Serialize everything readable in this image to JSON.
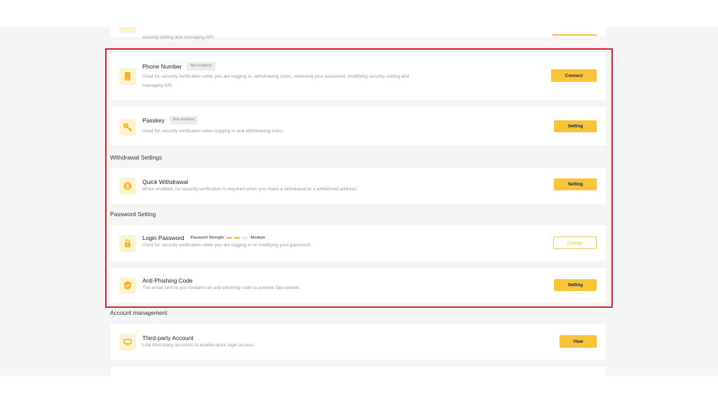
{
  "top_card": {
    "desc_tail": "security setting and managing API."
  },
  "security_items": [
    {
      "title": "Phone Number",
      "badge": "Not enabled",
      "desc": "Used for security verification while you are logging in, withdrawing coins, retrieving your password, modifying security setting and managing API.",
      "button": "Connect",
      "icon": "phone-icon"
    },
    {
      "title": "Passkey",
      "badge": "Not enabled",
      "desc": "Used for security verification when logging in and withdrawing coins.",
      "button": "Setting",
      "icon": "passkey-icon"
    }
  ],
  "withdrawal_section": {
    "title": "Withdrawal Settings",
    "items": [
      {
        "title": "Quick Withdrawal",
        "desc": "When enabled, no security verification is required when you make a withdrawal to a whitelisted address.",
        "button": "Setting",
        "icon": "quick-withdrawal-icon"
      }
    ]
  },
  "password_section": {
    "title": "Password Setting",
    "items": [
      {
        "title": "Login Password",
        "strength_label": "Password Strength:",
        "strength_value": "Medium",
        "strength_level": 2,
        "strength_max": 3,
        "desc": "Used for security verification while you are logging in or modifying your password.",
        "button": "Change",
        "icon": "lock-icon"
      },
      {
        "title": "Anti-Phishing Code",
        "desc": "The email sent to you contains an anti-phishing code to prevent fake emails.",
        "button": "Setting",
        "icon": "shield-check-icon"
      }
    ]
  },
  "account_section": {
    "title": "Account management",
    "items": [
      {
        "title": "Third-party Account",
        "desc": "Link third-party accounts to enable quick login access.",
        "button": "View",
        "icon": "third-party-account-icon"
      }
    ]
  },
  "colors": {
    "accent": "#f8c53a",
    "highlight_border": "#df1f26",
    "page_bg": "#f5f5f5"
  }
}
